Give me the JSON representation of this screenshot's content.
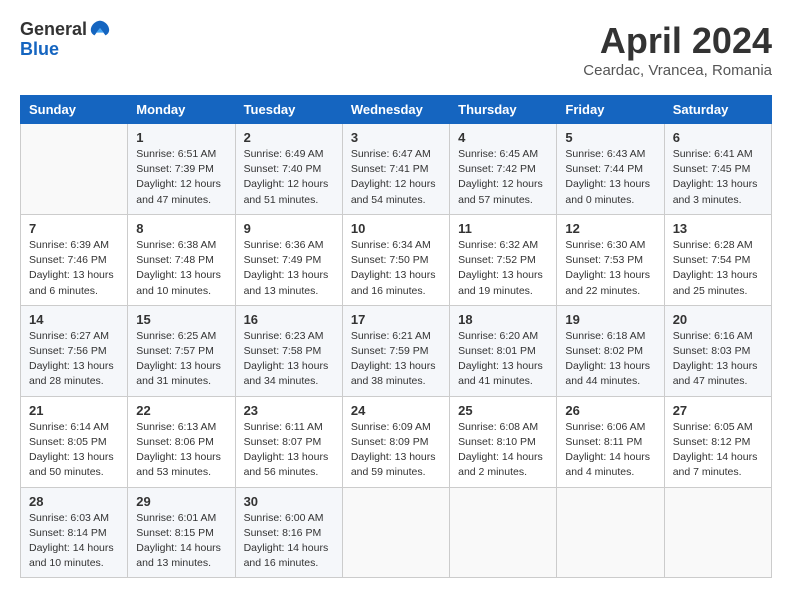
{
  "header": {
    "logo_general": "General",
    "logo_blue": "Blue",
    "month_title": "April 2024",
    "location": "Ceardac, Vrancea, Romania"
  },
  "weekdays": [
    "Sunday",
    "Monday",
    "Tuesday",
    "Wednesday",
    "Thursday",
    "Friday",
    "Saturday"
  ],
  "weeks": [
    [
      {
        "day": "",
        "info": ""
      },
      {
        "day": "1",
        "info": "Sunrise: 6:51 AM\nSunset: 7:39 PM\nDaylight: 12 hours\nand 47 minutes."
      },
      {
        "day": "2",
        "info": "Sunrise: 6:49 AM\nSunset: 7:40 PM\nDaylight: 12 hours\nand 51 minutes."
      },
      {
        "day": "3",
        "info": "Sunrise: 6:47 AM\nSunset: 7:41 PM\nDaylight: 12 hours\nand 54 minutes."
      },
      {
        "day": "4",
        "info": "Sunrise: 6:45 AM\nSunset: 7:42 PM\nDaylight: 12 hours\nand 57 minutes."
      },
      {
        "day": "5",
        "info": "Sunrise: 6:43 AM\nSunset: 7:44 PM\nDaylight: 13 hours\nand 0 minutes."
      },
      {
        "day": "6",
        "info": "Sunrise: 6:41 AM\nSunset: 7:45 PM\nDaylight: 13 hours\nand 3 minutes."
      }
    ],
    [
      {
        "day": "7",
        "info": "Sunrise: 6:39 AM\nSunset: 7:46 PM\nDaylight: 13 hours\nand 6 minutes."
      },
      {
        "day": "8",
        "info": "Sunrise: 6:38 AM\nSunset: 7:48 PM\nDaylight: 13 hours\nand 10 minutes."
      },
      {
        "day": "9",
        "info": "Sunrise: 6:36 AM\nSunset: 7:49 PM\nDaylight: 13 hours\nand 13 minutes."
      },
      {
        "day": "10",
        "info": "Sunrise: 6:34 AM\nSunset: 7:50 PM\nDaylight: 13 hours\nand 16 minutes."
      },
      {
        "day": "11",
        "info": "Sunrise: 6:32 AM\nSunset: 7:52 PM\nDaylight: 13 hours\nand 19 minutes."
      },
      {
        "day": "12",
        "info": "Sunrise: 6:30 AM\nSunset: 7:53 PM\nDaylight: 13 hours\nand 22 minutes."
      },
      {
        "day": "13",
        "info": "Sunrise: 6:28 AM\nSunset: 7:54 PM\nDaylight: 13 hours\nand 25 minutes."
      }
    ],
    [
      {
        "day": "14",
        "info": "Sunrise: 6:27 AM\nSunset: 7:56 PM\nDaylight: 13 hours\nand 28 minutes."
      },
      {
        "day": "15",
        "info": "Sunrise: 6:25 AM\nSunset: 7:57 PM\nDaylight: 13 hours\nand 31 minutes."
      },
      {
        "day": "16",
        "info": "Sunrise: 6:23 AM\nSunset: 7:58 PM\nDaylight: 13 hours\nand 34 minutes."
      },
      {
        "day": "17",
        "info": "Sunrise: 6:21 AM\nSunset: 7:59 PM\nDaylight: 13 hours\nand 38 minutes."
      },
      {
        "day": "18",
        "info": "Sunrise: 6:20 AM\nSunset: 8:01 PM\nDaylight: 13 hours\nand 41 minutes."
      },
      {
        "day": "19",
        "info": "Sunrise: 6:18 AM\nSunset: 8:02 PM\nDaylight: 13 hours\nand 44 minutes."
      },
      {
        "day": "20",
        "info": "Sunrise: 6:16 AM\nSunset: 8:03 PM\nDaylight: 13 hours\nand 47 minutes."
      }
    ],
    [
      {
        "day": "21",
        "info": "Sunrise: 6:14 AM\nSunset: 8:05 PM\nDaylight: 13 hours\nand 50 minutes."
      },
      {
        "day": "22",
        "info": "Sunrise: 6:13 AM\nSunset: 8:06 PM\nDaylight: 13 hours\nand 53 minutes."
      },
      {
        "day": "23",
        "info": "Sunrise: 6:11 AM\nSunset: 8:07 PM\nDaylight: 13 hours\nand 56 minutes."
      },
      {
        "day": "24",
        "info": "Sunrise: 6:09 AM\nSunset: 8:09 PM\nDaylight: 13 hours\nand 59 minutes."
      },
      {
        "day": "25",
        "info": "Sunrise: 6:08 AM\nSunset: 8:10 PM\nDaylight: 14 hours\nand 2 minutes."
      },
      {
        "day": "26",
        "info": "Sunrise: 6:06 AM\nSunset: 8:11 PM\nDaylight: 14 hours\nand 4 minutes."
      },
      {
        "day": "27",
        "info": "Sunrise: 6:05 AM\nSunset: 8:12 PM\nDaylight: 14 hours\nand 7 minutes."
      }
    ],
    [
      {
        "day": "28",
        "info": "Sunrise: 6:03 AM\nSunset: 8:14 PM\nDaylight: 14 hours\nand 10 minutes."
      },
      {
        "day": "29",
        "info": "Sunrise: 6:01 AM\nSunset: 8:15 PM\nDaylight: 14 hours\nand 13 minutes."
      },
      {
        "day": "30",
        "info": "Sunrise: 6:00 AM\nSunset: 8:16 PM\nDaylight: 14 hours\nand 16 minutes."
      },
      {
        "day": "",
        "info": ""
      },
      {
        "day": "",
        "info": ""
      },
      {
        "day": "",
        "info": ""
      },
      {
        "day": "",
        "info": ""
      }
    ]
  ]
}
